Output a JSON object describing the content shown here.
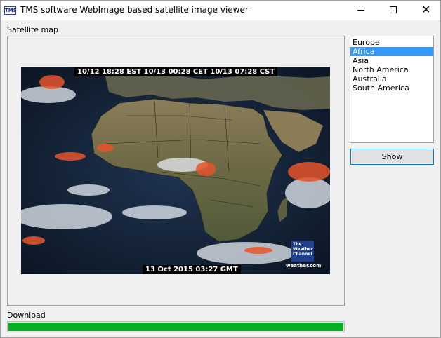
{
  "window": {
    "title": "TMS software WebImage based satellite image viewer",
    "icon_text": "TMS",
    "controls": {
      "minimize": "minimize-icon",
      "maximize": "maximize-icon",
      "close": "close-icon",
      "close_glyph": "✕"
    }
  },
  "map": {
    "label": "Satellite map",
    "caption_top": "10/12 18:28 EST  10/13 00:28 CET  10/13 07:28 CST",
    "caption_bottom": "13 Oct 2015 03:27 GMT",
    "logo_lines": [
      "The",
      "Weather",
      "Channel"
    ],
    "logo_url": "weather.com"
  },
  "regions": {
    "items": [
      "Europe",
      "Africa",
      "Asia",
      "North America",
      "Australia",
      "South America"
    ],
    "selected_index": 1
  },
  "show_button": {
    "label": "Show"
  },
  "download": {
    "label": "Download",
    "progress": 1.0
  },
  "colors": {
    "accent": "#0078d7",
    "selection": "#3399ff",
    "progress": "#06b025"
  }
}
